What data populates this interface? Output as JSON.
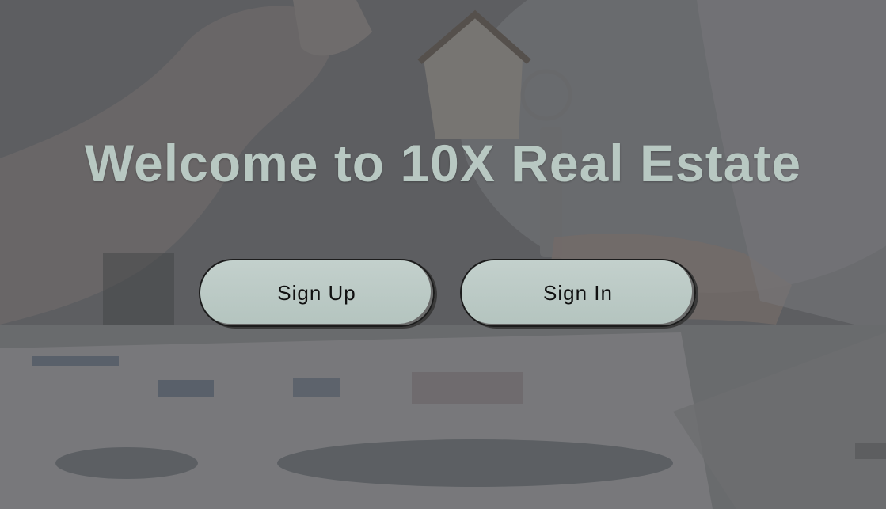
{
  "hero": {
    "title": "Welcome to 10X Real Estate"
  },
  "actions": {
    "sign_up_label": "Sign Up",
    "sign_in_label": "Sign In"
  },
  "colors": {
    "title": "#b8c8c2",
    "button_fill": "#bccbc6",
    "button_text": "#111111",
    "overlay": "#3a3b3e"
  }
}
